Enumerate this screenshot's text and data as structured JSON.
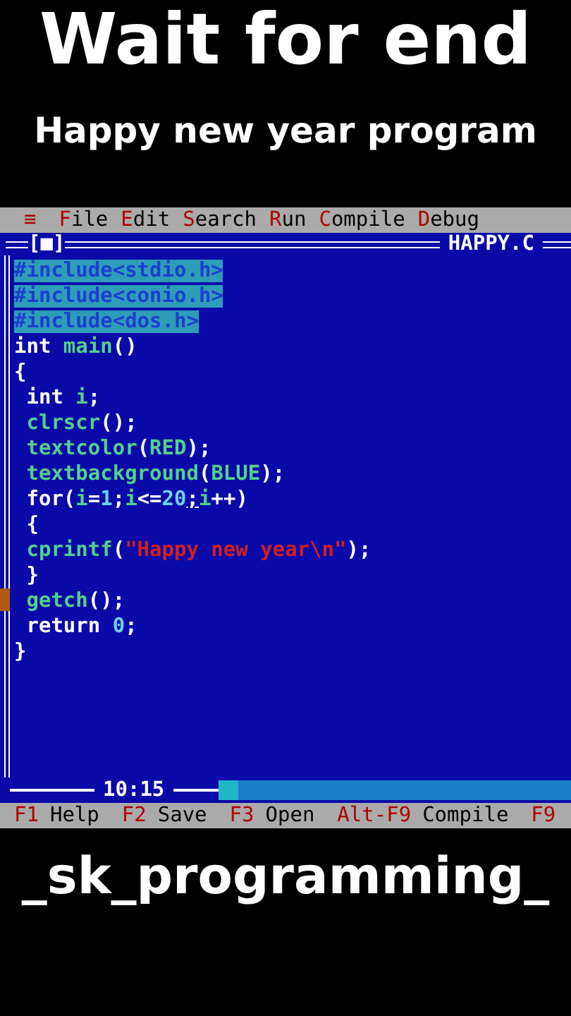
{
  "caption": {
    "title": "Wait for end",
    "subtitle": "Happy new year program"
  },
  "menu_bar": {
    "system_menu": "≡",
    "items": [
      "File",
      "Edit",
      "Search",
      "Run",
      "Compile",
      "Debug"
    ]
  },
  "editor": {
    "close_box": "[■]",
    "filename": "HAPPY.C",
    "cursor_position": "10:15",
    "lines": [
      {
        "selected": true,
        "tokens": [
          {
            "kind": "plain",
            "text": "#include<stdio.h>"
          }
        ]
      },
      {
        "selected": true,
        "tokens": [
          {
            "kind": "plain",
            "text": "#include<conio.h>"
          }
        ]
      },
      {
        "selected": true,
        "tokens": [
          {
            "kind": "plain",
            "text": "#include<dos.h>"
          }
        ]
      },
      {
        "selected": false,
        "tokens": [
          {
            "kind": "keyword",
            "text": "int "
          },
          {
            "kind": "ident",
            "text": "main"
          },
          {
            "kind": "plain",
            "text": "()"
          }
        ]
      },
      {
        "selected": false,
        "tokens": [
          {
            "kind": "plain",
            "text": "{"
          }
        ]
      },
      {
        "selected": false,
        "tokens": [
          {
            "kind": "keyword",
            "text": " int "
          },
          {
            "kind": "ident",
            "text": "i"
          },
          {
            "kind": "plain",
            "text": ";"
          }
        ]
      },
      {
        "selected": false,
        "tokens": [
          {
            "kind": "ident",
            "text": " clrscr"
          },
          {
            "kind": "plain",
            "text": "();"
          }
        ]
      },
      {
        "selected": false,
        "tokens": [
          {
            "kind": "ident",
            "text": " textcolor"
          },
          {
            "kind": "plain",
            "text": "("
          },
          {
            "kind": "ident",
            "text": "RED"
          },
          {
            "kind": "plain",
            "text": ");"
          }
        ]
      },
      {
        "selected": false,
        "tokens": [
          {
            "kind": "ident",
            "text": " textbackground"
          },
          {
            "kind": "plain",
            "text": "("
          },
          {
            "kind": "ident",
            "text": "BLUE"
          },
          {
            "kind": "plain",
            "text": ");"
          }
        ]
      },
      {
        "selected": false,
        "tokens": [
          {
            "kind": "keyword",
            "text": " for"
          },
          {
            "kind": "plain",
            "text": "("
          },
          {
            "kind": "ident",
            "text": "i"
          },
          {
            "kind": "plain",
            "text": "="
          },
          {
            "kind": "number",
            "text": "1"
          },
          {
            "kind": "plain",
            "text": ";"
          },
          {
            "kind": "ident",
            "text": "i"
          },
          {
            "kind": "plain",
            "text": "<="
          },
          {
            "kind": "number",
            "text": "20"
          },
          {
            "kind": "cursor",
            "text": ";"
          },
          {
            "kind": "ident",
            "text": "i"
          },
          {
            "kind": "plain",
            "text": "++)"
          }
        ]
      },
      {
        "selected": false,
        "tokens": [
          {
            "kind": "plain",
            "text": " {"
          }
        ]
      },
      {
        "selected": false,
        "tokens": [
          {
            "kind": "ident",
            "text": " cprintf"
          },
          {
            "kind": "plain",
            "text": "("
          },
          {
            "kind": "string",
            "text": "\"Happy new year\\n\""
          },
          {
            "kind": "plain",
            "text": ");"
          }
        ]
      },
      {
        "selected": false,
        "tokens": [
          {
            "kind": "plain",
            "text": " }"
          }
        ]
      },
      {
        "selected": false,
        "tokens": [
          {
            "kind": "ident",
            "text": " getch"
          },
          {
            "kind": "plain",
            "text": "();"
          }
        ]
      },
      {
        "selected": false,
        "tokens": [
          {
            "kind": "keyword",
            "text": " return "
          },
          {
            "kind": "number",
            "text": "0"
          },
          {
            "kind": "plain",
            "text": ";"
          }
        ]
      },
      {
        "selected": false,
        "tokens": [
          {
            "kind": "plain",
            "text": "}"
          }
        ]
      }
    ]
  },
  "status_bar": [
    {
      "key": "F1",
      "label": "Help"
    },
    {
      "key": "F2",
      "label": "Save"
    },
    {
      "key": "F3",
      "label": "Open"
    },
    {
      "key": "Alt-F9",
      "label": "Compile"
    },
    {
      "key": "F9"
    }
  ],
  "footer": {
    "text": "_sk_programming_"
  }
}
